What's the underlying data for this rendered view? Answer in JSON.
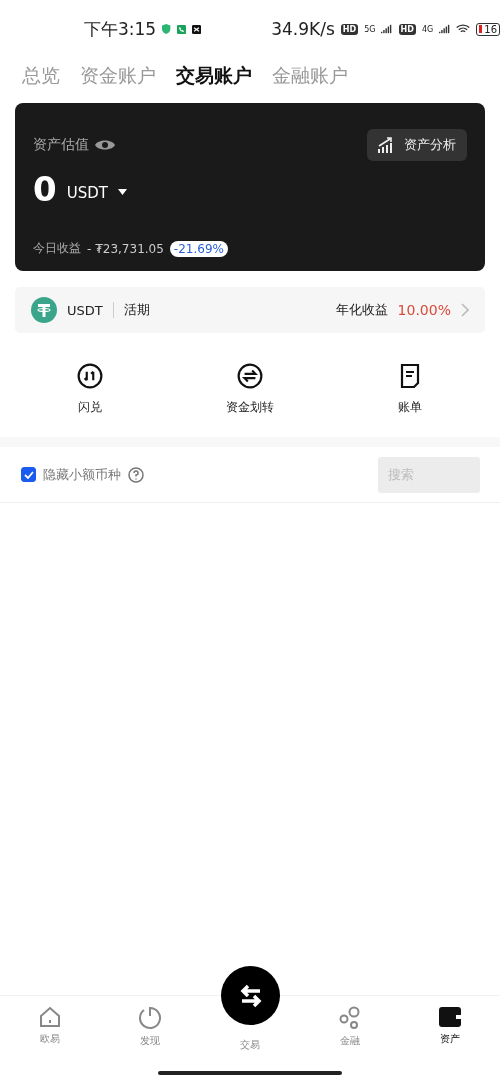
{
  "status_bar": {
    "time": "下午3:15",
    "speed": "34.9K/s",
    "hd_badges": [
      "HD",
      "HD"
    ],
    "networks": [
      "5G",
      "4G"
    ],
    "battery": "16"
  },
  "tabs": [
    {
      "label": "总览",
      "selected": false
    },
    {
      "label": "资金账户",
      "selected": false
    },
    {
      "label": "交易账户",
      "selected": true
    },
    {
      "label": "金融账户",
      "selected": false
    }
  ],
  "asset_card": {
    "title": "资产估值",
    "analysis_button": "资产分析",
    "amount": "0",
    "currency": "USDT",
    "today_label": "今日收益",
    "today_value": "- ₮23,731.05",
    "today_change": "-21.69%"
  },
  "earn_row": {
    "coin": "USDT",
    "term": "活期",
    "yield_label": "年化收益",
    "yield_value": "10.00%"
  },
  "actions": [
    {
      "label": "闪兑",
      "kind": "swap"
    },
    {
      "label": "资金划转",
      "kind": "transfer"
    },
    {
      "label": "账单",
      "kind": "bill"
    }
  ],
  "filter": {
    "label": "隐藏小额币种",
    "checked": true,
    "search_placeholder": "搜索"
  },
  "bottom_nav": [
    {
      "label": "欧易",
      "kind": "home",
      "selected": false
    },
    {
      "label": "发现",
      "kind": "discover",
      "selected": false
    },
    {
      "label": "交易",
      "kind": "trade",
      "selected": false
    },
    {
      "label": "金融",
      "kind": "finance",
      "selected": false
    },
    {
      "label": "资产",
      "kind": "wallet",
      "selected": true
    }
  ]
}
